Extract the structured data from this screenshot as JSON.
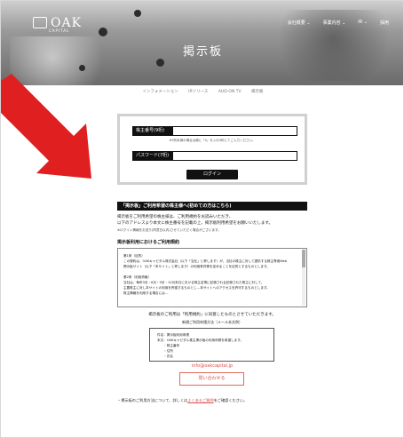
{
  "header": {
    "logo_text": "OAK",
    "logo_sub": "CAPITAL",
    "nav": [
      "会社概要 ⌄",
      "事業内容 ⌄",
      "IR ⌄",
      "採用"
    ],
    "title": "掲示板"
  },
  "breadcrumb": [
    "インフォメーション",
    "IRリリース",
    "AUD-ON TV",
    "掲示板"
  ],
  "login": {
    "shareholder_label": "株主番号(9桁)",
    "shareholder_note": "※9桁未満の場合は頭に「0」を入れ9桁にてご入力ください。",
    "password_label": "パスワード(7桁)",
    "submit_label": "ログイン"
  },
  "info": {
    "banner": "「掲示板」ご利用希望の株主様へ(初めての方はこちら)",
    "line1": "掲示板をご利用希望の株主様は、ご利用規約をお読みいただき、",
    "line2": "以下のアドレスより本文に株主番号を記載の上、掲示板利用希望をお願いいたします。",
    "line3": "※ログイン情報をお送り(同意日以内)させていただく場合がございます。",
    "section_title": "掲示板利用におけるご利用規約",
    "terms": [
      "第1条（目的）",
      "この規約は、OAKキャピタル株式会社（以下「当社」と称します）が、当社の株主に対して提供する株主専用Web",
      "掲示板サイト（以下「本サイト」と称します）の利用条件等を定めることを目的とするものとします。",
      "",
      "第2条（利用資格）",
      "当社は、毎年3月・6月・9月・12月末日における株主名簿に記録される記録された株主に対して、",
      "主要株主に対し本サイトの利用を許諾するものとし…本サイトへのアクセスを許可するものとします。",
      "株主情報を利用する場合には…"
    ],
    "consent": "掲示板のご利用は「利用規約」に同意したものとさせていただきます。",
    "box_title": "新規ご利用申請方法（メール本文例）",
    "box_lines": [
      "件名：掲示板利用申請",
      "本文：OAKキャピタル株主掲示板の利用申請を希望します。",
      "　　・株主番号",
      "　　・住所",
      "　　・氏名"
    ],
    "email": "info@oakcapital.jp",
    "contact_button": "問い合わせる",
    "footer_prefix": "・掲示板のご利用方法について、詳しくは",
    "footer_link": "よくあるご質問",
    "footer_suffix": "をご確認ください。"
  },
  "colors": {
    "accent_red": "#e02020",
    "link_red": "#d9534f",
    "banner_black": "#111111"
  }
}
